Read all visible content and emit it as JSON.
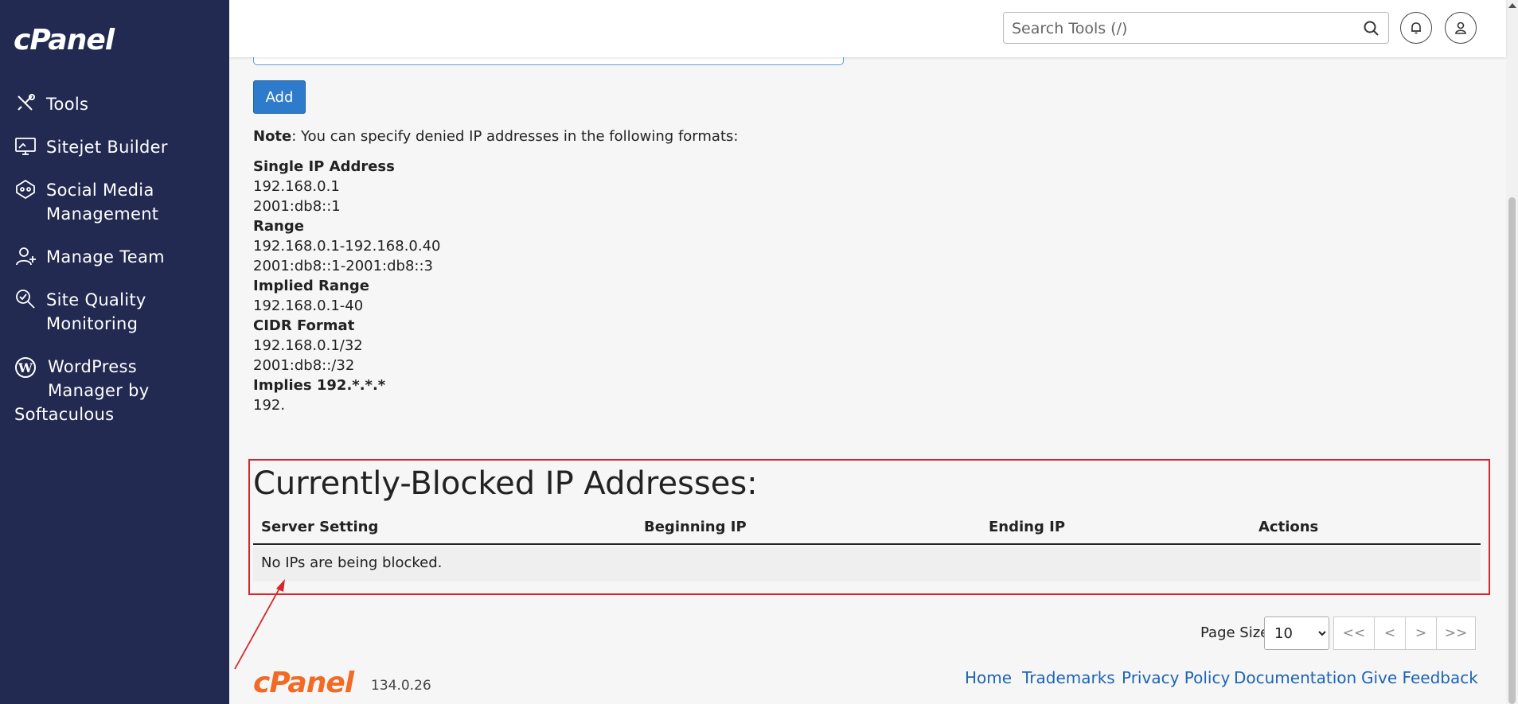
{
  "sidebar": {
    "logo": "cPanel",
    "items": [
      {
        "label": "Tools",
        "icon": "tools-icon"
      },
      {
        "label": "Sitejet Builder",
        "icon": "monitor-icon"
      },
      {
        "label_line1": "Social Media",
        "label_line2": "Management",
        "icon": "social-media-icon"
      },
      {
        "label": "Manage Team",
        "icon": "manage-team-icon"
      },
      {
        "label_line1": "Site Quality",
        "label_line2": "Monitoring",
        "icon": "site-quality-icon"
      },
      {
        "label_line1": "WordPress",
        "label_line2": "Manager by",
        "label_line3": "Softaculous",
        "icon": "wordpress-icon"
      }
    ]
  },
  "topbar": {
    "search_placeholder": "Search Tools (/)"
  },
  "form": {
    "add_label": "Add"
  },
  "note": {
    "prefix": "Note",
    "text": ": You can specify denied IP addresses in the following formats:",
    "sections": [
      {
        "heading": "Single IP Address",
        "lines": [
          "192.168.0.1",
          "2001:db8::1"
        ]
      },
      {
        "heading": "Range",
        "lines": [
          "192.168.0.1-192.168.0.40",
          "2001:db8::1-2001:db8::3"
        ]
      },
      {
        "heading": "Implied Range",
        "lines": [
          "192.168.0.1-40"
        ]
      },
      {
        "heading": "CIDR Format",
        "lines": [
          "192.168.0.1/32",
          "2001:db8::/32"
        ]
      },
      {
        "heading": "Implies 192.*.*.*",
        "lines": [
          "192."
        ]
      }
    ]
  },
  "blocked": {
    "title": "Currently-Blocked IP Addresses:",
    "columns": [
      "Server Setting",
      "Beginning IP",
      "Ending IP",
      "Actions"
    ],
    "empty_message": "No IPs are being blocked."
  },
  "pagination": {
    "page_size_label": "Page Size",
    "page_size_value": "10",
    "buttons": [
      "<<",
      "<",
      ">",
      ">>"
    ]
  },
  "footer": {
    "logo": "cPanel",
    "version": "134.0.26",
    "links": [
      "Home",
      "Trademarks",
      "Privacy Policy",
      "Documentation",
      "Give Feedback"
    ]
  },
  "colors": {
    "sidebar_bg": "#232a52",
    "accent_blue": "#2f7bcb",
    "highlight_red": "#d6262b",
    "footer_logo": "#f26a25",
    "link": "#1d64b5"
  }
}
